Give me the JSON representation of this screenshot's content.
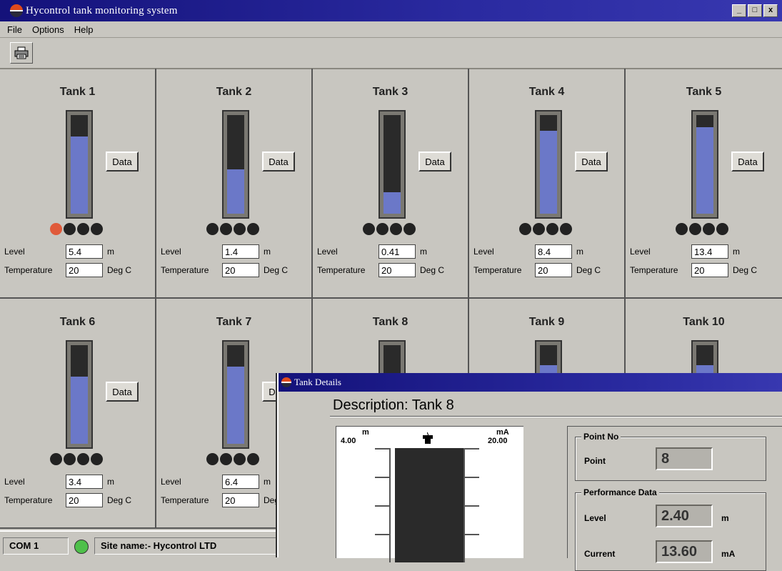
{
  "window": {
    "title": "Hycontrol tank monitoring system",
    "buttons": [
      "_",
      "□",
      "x"
    ]
  },
  "menu": {
    "items": [
      "File",
      "Options",
      "Help"
    ]
  },
  "toolbar": {
    "print_icon": "printer-icon"
  },
  "tanks": [
    {
      "name": "Tank 1",
      "level_value": "5.4",
      "temperature_value": "20",
      "fill_fraction": 0.78,
      "leds": [
        "alarm",
        "off",
        "off",
        "off"
      ],
      "show_fields": true
    },
    {
      "name": "Tank 2",
      "level_value": "1.4",
      "temperature_value": "20",
      "fill_fraction": 0.45,
      "leds": [
        "off",
        "off",
        "off",
        "off"
      ],
      "show_fields": true
    },
    {
      "name": "Tank 3",
      "level_value": "0.41",
      "temperature_value": "20",
      "fill_fraction": 0.22,
      "leds": [
        "off",
        "off",
        "off",
        "off"
      ],
      "show_fields": true
    },
    {
      "name": "Tank 4",
      "level_value": "8.4",
      "temperature_value": "20",
      "fill_fraction": 0.84,
      "leds": [
        "off",
        "off",
        "off",
        "off"
      ],
      "show_fields": true
    },
    {
      "name": "Tank 5",
      "level_value": "13.4",
      "temperature_value": "20",
      "fill_fraction": 0.88,
      "leds": [
        "off",
        "off",
        "off",
        "off"
      ],
      "show_fields": true
    },
    {
      "name": "Tank 6",
      "level_value": "3.4",
      "temperature_value": "20",
      "fill_fraction": 0.68,
      "leds": [
        "off",
        "off",
        "off",
        "off"
      ],
      "show_fields": true
    },
    {
      "name": "Tank 7",
      "level_value": "6.4",
      "temperature_value": "20",
      "fill_fraction": 0.78,
      "leds": [
        "off",
        "off",
        "off",
        "off"
      ],
      "show_fields": true
    },
    {
      "name": "Tank 8",
      "fill_fraction": 0.0,
      "show_fields": false
    },
    {
      "name": "Tank 9",
      "fill_fraction": 0.8,
      "show_fields": false
    },
    {
      "name": "Tank 10",
      "fill_fraction": 0.8,
      "show_fields": false
    }
  ],
  "labels": {
    "level": "Level",
    "level_unit": "m",
    "temperature": "Temperature",
    "temperature_unit": "Deg C",
    "data_button": "Data"
  },
  "status": {
    "port": "COM 1",
    "site": "Site name:- Hycontrol LTD",
    "connection_color": "#4ec04a"
  },
  "details": {
    "title": "Tank Details",
    "description": "Description: Tank 8",
    "scale": {
      "left_unit": "m",
      "left_value": "4.00",
      "right_unit": "mA",
      "right_value": "20.00"
    },
    "point_group": "Point No",
    "point_label": "Point",
    "point_value": "8",
    "perf_group": "Performance Data",
    "level_label": "Level",
    "level_value": "2.40",
    "level_unit": "m",
    "current_label": "Current",
    "current_value": "13.60",
    "current_unit": "mA"
  }
}
